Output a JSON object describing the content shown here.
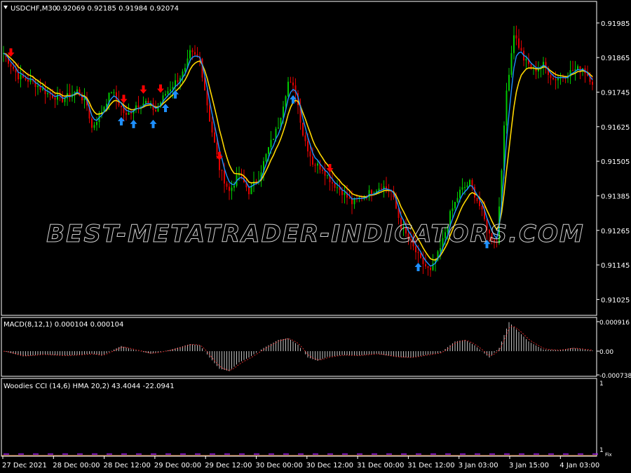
{
  "header": {
    "symbol": "USDCHF,M30",
    "ohlc": "0.92069 0.92185 0.91984 0.92074"
  },
  "watermark": "BEST-METATRADER-INDICATORS.COM",
  "colors": {
    "background": "#000000",
    "axis": "#ffffff",
    "candle_up": "#00c800",
    "candle_down": "#e00000",
    "ma_fast": "#1e90ff",
    "ma_slow": "#ffd700",
    "arrow_sell": "#ff0000",
    "arrow_buy": "#1e90ff",
    "macd_hist": "#c0c0c0",
    "macd_signal": "#ff3030",
    "cci_marks": "#a020f0"
  },
  "chart_data": [
    {
      "type": "candlestick",
      "ylim": [
        0.9097,
        0.9206
      ],
      "y_ticks": [
        "0.91985",
        "0.91865",
        "0.91745",
        "0.91625",
        "0.91505",
        "0.91385",
        "0.91265",
        "0.91145",
        "0.91025"
      ],
      "x_ticks": [
        "27 Dec 2021",
        "28 Dec 00:00",
        "28 Dec 12:00",
        "29 Dec 00:00",
        "29 Dec 12:00",
        "30 Dec 00:00",
        "30 Dec 12:00",
        "31 Dec 00:00",
        "31 Dec 12:00",
        "3 Jan 03:00",
        "3 Jan 15:00",
        "4 Jan 03:00"
      ],
      "close_path": [
        [
          0,
          0.9188
        ],
        [
          6,
          0.918
        ],
        [
          12,
          0.9178
        ],
        [
          18,
          0.9174
        ],
        [
          24,
          0.9172
        ],
        [
          30,
          0.9175
        ],
        [
          34,
          0.917
        ],
        [
          36,
          0.9162
        ],
        [
          40,
          0.9168
        ],
        [
          44,
          0.9175
        ],
        [
          46,
          0.9172
        ],
        [
          50,
          0.9166
        ],
        [
          54,
          0.917
        ],
        [
          58,
          0.9171
        ],
        [
          62,
          0.9168
        ],
        [
          66,
          0.9174
        ],
        [
          70,
          0.9178
        ],
        [
          74,
          0.9182
        ],
        [
          76,
          0.9188
        ],
        [
          80,
          0.9186
        ],
        [
          84,
          0.9165
        ],
        [
          88,
          0.9148
        ],
        [
          92,
          0.914
        ],
        [
          96,
          0.9146
        ],
        [
          100,
          0.914
        ],
        [
          104,
          0.9145
        ],
        [
          108,
          0.9155
        ],
        [
          112,
          0.9163
        ],
        [
          116,
          0.9178
        ],
        [
          119,
          0.9175
        ],
        [
          122,
          0.916
        ],
        [
          126,
          0.915
        ],
        [
          130,
          0.9148
        ],
        [
          134,
          0.9143
        ],
        [
          138,
          0.914
        ],
        [
          142,
          0.9136
        ],
        [
          146,
          0.9138
        ],
        [
          150,
          0.914
        ],
        [
          154,
          0.9142
        ],
        [
          158,
          0.914
        ],
        [
          162,
          0.9128
        ],
        [
          166,
          0.9122
        ],
        [
          170,
          0.9116
        ],
        [
          174,
          0.9112
        ],
        [
          178,
          0.912
        ],
        [
          182,
          0.9132
        ],
        [
          186,
          0.914
        ],
        [
          190,
          0.9143
        ],
        [
          194,
          0.9135
        ],
        [
          198,
          0.9125
        ],
        [
          201,
          0.9122
        ],
        [
          205,
          0.9175
        ],
        [
          208,
          0.9195
        ],
        [
          212,
          0.9186
        ],
        [
          216,
          0.9182
        ],
        [
          220,
          0.9184
        ],
        [
          224,
          0.9179
        ],
        [
          228,
          0.918
        ],
        [
          232,
          0.9182
        ],
        [
          236,
          0.9183
        ],
        [
          240,
          0.9178
        ]
      ],
      "sell_arrows": [
        3,
        49,
        57,
        64,
        88,
        133
      ],
      "buy_arrows": [
        48,
        53,
        61,
        66,
        70,
        118,
        169,
        197
      ]
    },
    {
      "type": "histogram",
      "label": "MACD(8,12,1) 0.000104 0.000104",
      "ylim": [
        -0.000738,
        0.000916
      ],
      "y_ticks": [
        "0.000916",
        "0.00",
        "-0.000738"
      ],
      "shape": [
        [
          0,
          0.0
        ],
        [
          8,
          -0.00016
        ],
        [
          16,
          -0.0001
        ],
        [
          24,
          -0.00014
        ],
        [
          30,
          -0.00012
        ],
        [
          36,
          -8e-05
        ],
        [
          40,
          -0.00014
        ],
        [
          48,
          0.00016
        ],
        [
          52,
          6e-05
        ],
        [
          60,
          -8e-05
        ],
        [
          68,
          4e-05
        ],
        [
          76,
          0.00022
        ],
        [
          80,
          0.00018
        ],
        [
          84,
          -0.0002
        ],
        [
          88,
          -0.00055
        ],
        [
          92,
          -0.00062
        ],
        [
          96,
          -0.00035
        ],
        [
          100,
          -0.0002
        ],
        [
          106,
          0.0001
        ],
        [
          112,
          0.00035
        ],
        [
          116,
          0.0004
        ],
        [
          120,
          0.0002
        ],
        [
          124,
          -0.0002
        ],
        [
          128,
          -0.0003
        ],
        [
          132,
          -0.00018
        ],
        [
          138,
          -0.00012
        ],
        [
          144,
          -0.00014
        ],
        [
          152,
          -8e-05
        ],
        [
          160,
          -0.00018
        ],
        [
          166,
          -0.0002
        ],
        [
          172,
          -0.00012
        ],
        [
          178,
          -5e-05
        ],
        [
          184,
          0.0003
        ],
        [
          188,
          0.00035
        ],
        [
          192,
          0.00018
        ],
        [
          198,
          -0.0002
        ],
        [
          202,
          0.0001
        ],
        [
          206,
          0.0009
        ],
        [
          210,
          0.0006
        ],
        [
          214,
          0.0003
        ],
        [
          220,
          5e-05
        ],
        [
          226,
          3e-05
        ],
        [
          232,
          0.0001
        ],
        [
          240,
          2e-05
        ]
      ]
    },
    {
      "type": "line",
      "label": "Woodies CCI (14,6) HMA 20,2) 43.4044 -22.0941",
      "y_ticks": [
        "1",
        "1"
      ],
      "x_extra_tick": "Fix"
    }
  ]
}
